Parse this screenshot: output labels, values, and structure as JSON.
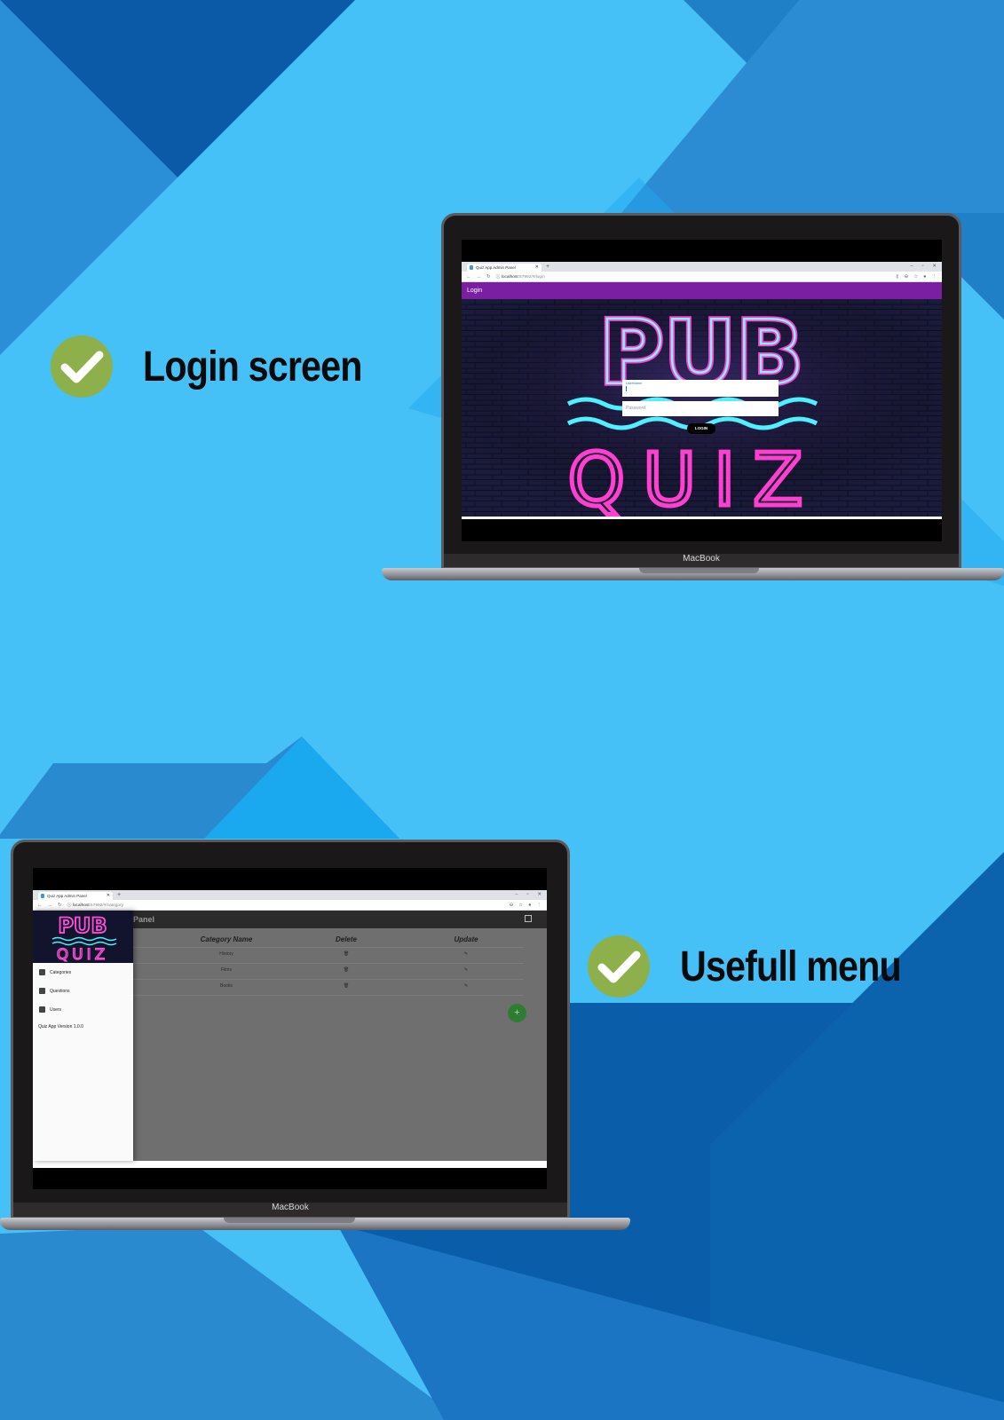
{
  "features": [
    {
      "label": "Login screen"
    },
    {
      "label": "Usefull menu"
    }
  ],
  "colors": {
    "background": "#45c1f7",
    "check_badge": "#8db04a",
    "login_header": "#7b1fa2",
    "fab": "#2e7d32"
  },
  "laptop_brand": "MacBook",
  "login_window": {
    "tab_title": "Quiz App Admin Panel",
    "url_host": "localhost",
    "url_path": ":57992/#/login",
    "header_title": "Login",
    "logo_top": "PUB",
    "logo_bottom": "QUIZ",
    "username_label": "UserName",
    "password_placeholder": "Password",
    "login_button": "LOGIN"
  },
  "admin_window": {
    "tab_title": "Quiz App Admin Panel",
    "url_host": "localhost",
    "url_path": ":57992/#/category",
    "title_fragment": "Panel",
    "logo_top": "PUB",
    "logo_bottom": "QUIZ",
    "drawer_items": [
      {
        "label": "Categories",
        "icon": "person-icon"
      },
      {
        "label": "Questions",
        "icon": "calendar-icon"
      },
      {
        "label": "Users",
        "icon": "folder-icon"
      }
    ],
    "version": "Quiz App Version 1.0.0",
    "table": {
      "headers": [
        "Category Name",
        "Delete",
        "Update"
      ],
      "rows": [
        {
          "name": "History"
        },
        {
          "name": "Films"
        },
        {
          "name": "Books"
        }
      ]
    },
    "fab_label": "+"
  }
}
